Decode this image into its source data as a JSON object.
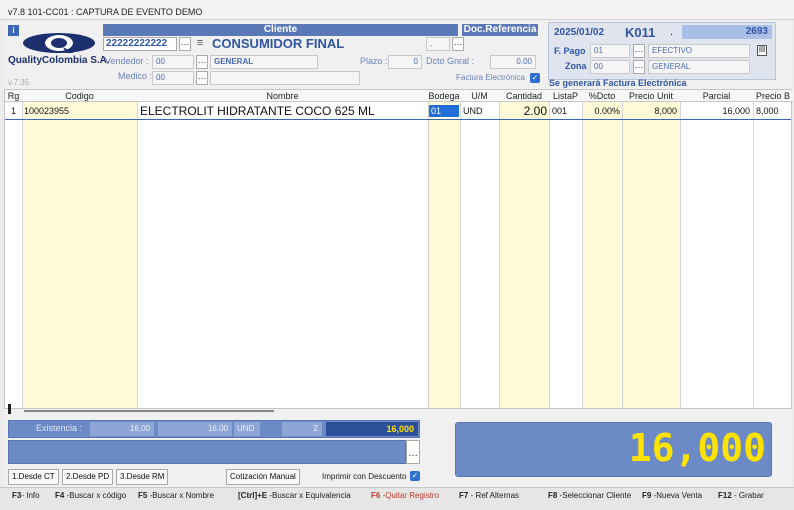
{
  "window": {
    "title": "v7.8 101-CC01 : CAPTURA DE EVENTO DEMO"
  },
  "company": {
    "name": "QualityColombia S.A.",
    "version": "v.7.35"
  },
  "cliente": {
    "header": "Cliente",
    "id": "22222222222",
    "name": "CONSUMIDOR FINAL",
    "vendedor_label": "Vendedor :",
    "vendedor_code": "00",
    "vendedor_name": "GENERAL",
    "medico_label": "Medico :",
    "medico_code": "00",
    "plazo_label": "Plazo :",
    "plazo_value": "0",
    "dcto_label": "Dcto Gnral :",
    "dcto_value": "0.00",
    "factura_label": "Factura Electrónica"
  },
  "docref": {
    "header": "Doc.Referencia",
    "value": "."
  },
  "documento": {
    "date": "2025/01/02",
    "code": "K011",
    "dot": ".",
    "number": "2693",
    "fpago_label": "F. Pago",
    "fpago_code": "01",
    "fpago_name": "EFECTIVO",
    "zona_label": "Zona",
    "zona_code": "00",
    "zona_name": "GENERAL",
    "notice": "Se generará Factura Electrónica"
  },
  "grid": {
    "columns": [
      "Rg",
      "Codigo",
      "Nombre",
      "Bodega",
      "U/M",
      "Cantidad",
      "ListaP",
      "%Dcto",
      "Precio Unit",
      "Parcial",
      "Precio B"
    ],
    "rows": [
      {
        "rg": "1",
        "codigo": "100023955",
        "nombre": "ELECTROLIT HIDRATANTE COCO 625 ML",
        "bodega": "01",
        "um": "UND",
        "cantidad": "2.00",
        "listap": "001",
        "dcto": "0.00%",
        "precio": "8,000",
        "parcial": "16,000",
        "preciob": "8,000"
      }
    ]
  },
  "existencia": {
    "label": "Existencia :",
    "v1": "16.00",
    "v2": "16.00",
    "unit": "UND",
    "count": "2",
    "total": "16,000"
  },
  "total": {
    "value": "16,000"
  },
  "buttons": {
    "desde_ct": "1.Desde CT",
    "desde_pd": "2.Desde PD",
    "desde_rm": "3.Desde RM",
    "cotizacion": "Cotización Manual",
    "imprimir": "Imprimir con Descuento"
  },
  "fkeys": [
    {
      "key": "F3",
      "label": "- Info"
    },
    {
      "key": "F4",
      "label": " -Buscar x código"
    },
    {
      "key": "F5",
      "label": " -Buscar x Nombre"
    },
    {
      "key": "[Ctrl]+E",
      "label": " -Buscar x Equivalencia"
    },
    {
      "key": "F6",
      "label": " -Quitar Registro"
    },
    {
      "key": "F7",
      "label": " - Ref Alternas"
    },
    {
      "key": "F8",
      "label": " -Seleccionar Cliente"
    },
    {
      "key": "F9",
      "label": " -Nueva Venta"
    },
    {
      "key": "F12",
      "label": " - Grabar"
    }
  ],
  "colors": {
    "accent": "#5b79b6",
    "total_text": "#ffe200",
    "highlight": "#fffbd8",
    "remove": "#c0392b"
  }
}
